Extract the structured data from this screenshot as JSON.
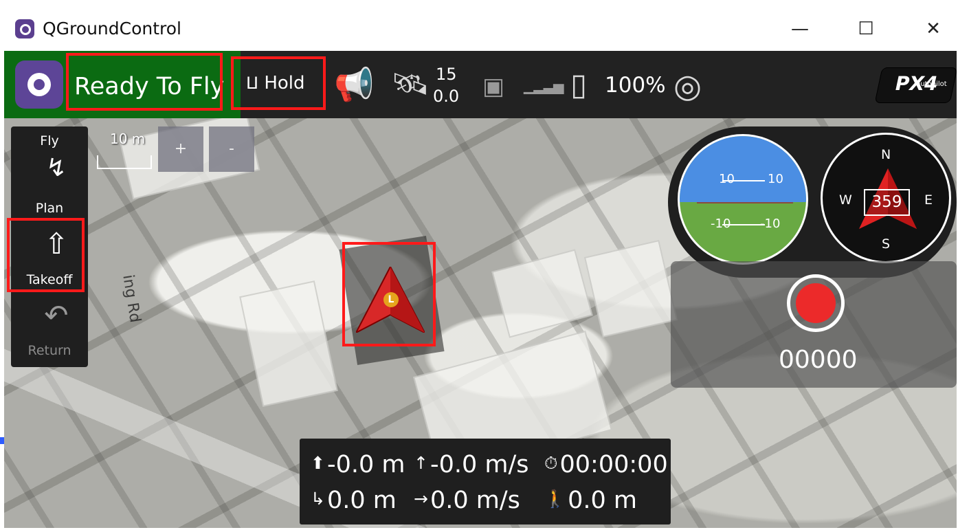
{
  "window": {
    "title": "QGroundControl",
    "controls": {
      "minimize": "—",
      "maximize": "☐",
      "close": "✕"
    }
  },
  "toolbar": {
    "status": "Ready To Fly",
    "mode": "Hold",
    "gps": {
      "satellites": "15",
      "hdop": "0.0"
    },
    "battery": "100%",
    "brand": {
      "logo_text": "PX4",
      "sub_text": "autopilot"
    }
  },
  "toolstrip": {
    "items": [
      {
        "label": "Fly"
      },
      {
        "label": "Plan"
      },
      {
        "label": "Takeoff"
      },
      {
        "label": "Return"
      }
    ]
  },
  "map": {
    "scale": "10 m",
    "zoom_in": "+",
    "zoom_out": "-",
    "road_label": "ing Rd",
    "vehicle_label": "L"
  },
  "instruments": {
    "attitude": {
      "pitch_up_left": "10",
      "pitch_up_right": "10",
      "pitch_down_left": "-10",
      "pitch_down_right": "-10"
    },
    "compass": {
      "heading": "359",
      "north": "N",
      "east": "E",
      "south": "S",
      "west": "W"
    }
  },
  "camera": {
    "record_count": "00000"
  },
  "telemetry": {
    "altitude": "-0.0 m",
    "vertical_speed": "-0.0 m/s",
    "flight_time": "00:00:00",
    "distance": "0.0 m",
    "ground_speed": "0.0 m/s",
    "home_distance": "0.0 m"
  },
  "colors": {
    "toolbar_status": "#0b6b12",
    "toolbar": "#222222",
    "highlight": "#ff1a1a",
    "record": "#ec2a2a",
    "attitude_sky": "#4b8ee3",
    "attitude_ground": "#69a943"
  }
}
